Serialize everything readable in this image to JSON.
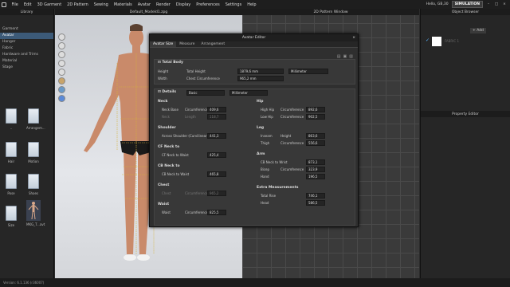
{
  "menubar": {
    "items": [
      "File",
      "Edit",
      "3D Garment",
      "2D Pattern",
      "Sewing",
      "Materials",
      "Avatar",
      "Render",
      "Display",
      "Preferences",
      "Settings",
      "Help"
    ],
    "user": "Hello, GB,30",
    "mode": "SIMULATION"
  },
  "library": {
    "title": "Library",
    "items": [
      "Garment",
      "Avatar",
      "Hanger",
      "Fabric",
      "Hardware and Trims",
      "Material",
      "Stage"
    ],
    "selected": 1,
    "thumbs": [
      "..",
      "Arrangem...",
      "Hair",
      "Motion",
      "Pose",
      "Shoes",
      "Size",
      "MKG_T...avt"
    ]
  },
  "viewport": {
    "tab": "Default_Modeld1.zpg"
  },
  "pattern": {
    "tab": "2D Pattern Window"
  },
  "objbrowser": {
    "title": "Object Browser",
    "add": "+ Add",
    "item": "FABRIC 1"
  },
  "propeditor": {
    "title": "Property Editor"
  },
  "status": {
    "text": "Version: 6.1.136 (r36007)"
  },
  "editor": {
    "title": "Avatar Editor",
    "tabs": [
      "Avatar Size",
      "Measure",
      "Arrangement"
    ],
    "total_body": {
      "label": "Total Body",
      "height_label": "Height",
      "height_sub": "Total Height",
      "height_val": "1879,6 mm",
      "unit": "Millimeter",
      "width_label": "Width",
      "width_sub": "Chest Circumference",
      "width_val": "965,2 mm"
    },
    "details": {
      "label": "Details",
      "mode": "Basic",
      "unit": "Millimeter"
    },
    "left": [
      {
        "group": "Neck",
        "rows": [
          [
            "Neck Base",
            "Circumference",
            "409,6",
            ""
          ],
          [
            "Neck",
            "Length",
            "118,7",
            "dim"
          ]
        ]
      },
      {
        "group": "Shoulder",
        "rows": [
          [
            "Across Shoulder (Curvilinear)",
            "",
            "441,3",
            ""
          ]
        ]
      },
      {
        "group": "CF Neck to",
        "rows": [
          [
            "CF Neck to Waist",
            "",
            "425,4",
            ""
          ]
        ]
      },
      {
        "group": "CB Neck to",
        "rows": [
          [
            "CB Neck to Waist",
            "",
            "465,8",
            ""
          ]
        ]
      },
      {
        "group": "Chest",
        "rows": [
          [
            "Chest",
            "Circumference",
            "965,2",
            "dim"
          ]
        ]
      },
      {
        "group": "Waist",
        "rows": [
          [
            "Waist",
            "Circumference",
            "825,5",
            ""
          ]
        ]
      }
    ],
    "right": [
      {
        "group": "Hip",
        "rows": [
          [
            "High Hip",
            "Circumference",
            "892,6"
          ],
          [
            "Low Hip",
            "Circumference",
            "902,5"
          ]
        ]
      },
      {
        "group": "Leg",
        "rows": [
          [
            "Inseam",
            "Height",
            "863,6"
          ],
          [
            "Thigh",
            "Circumference",
            "556,6"
          ]
        ]
      },
      {
        "group": "Arm",
        "rows": [
          [
            "CB Neck to Wrist",
            "",
            "873,1"
          ],
          [
            "Bicep",
            "Circumference",
            "323,9"
          ],
          [
            "Hand",
            "",
            "196,5"
          ]
        ]
      },
      {
        "group": "Extra Measurements",
        "rows": [
          [
            "Total Rise",
            "",
            "746,1"
          ],
          [
            "Head",
            "",
            "586,5"
          ]
        ]
      }
    ]
  }
}
